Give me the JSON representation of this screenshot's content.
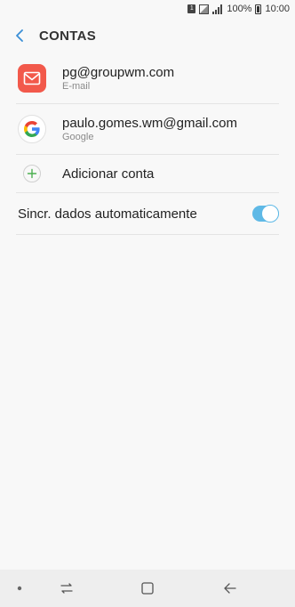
{
  "status_bar": {
    "sim": "1",
    "battery": "100%",
    "time": "10:00"
  },
  "header": {
    "title": "CONTAS"
  },
  "accounts": [
    {
      "title": "pg@groupwm.com",
      "subtitle": "E-mail",
      "icon": "email-icon"
    },
    {
      "title": "paulo.gomes.wm@gmail.com",
      "subtitle": "Google",
      "icon": "google-icon"
    }
  ],
  "add_account": {
    "label": "Adicionar conta"
  },
  "auto_sync": {
    "label": "Sincr. dados automaticamente",
    "enabled": true
  },
  "colors": {
    "accent": "#5fb9e6",
    "email_icon": "#f2594b",
    "add_icon": "#4caf50"
  }
}
